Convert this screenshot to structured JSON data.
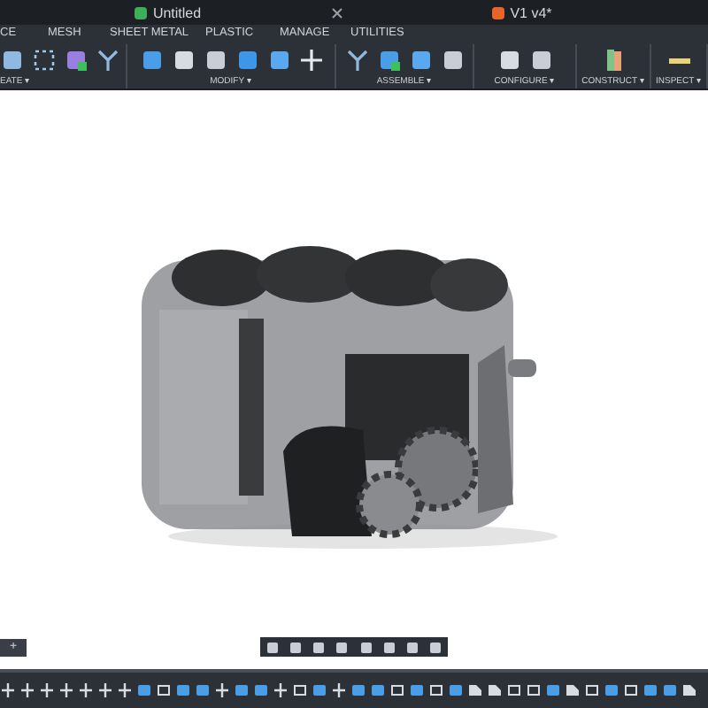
{
  "document_tabs": [
    {
      "title": "Untitled"
    },
    {
      "title": "V1 v4*"
    }
  ],
  "toolbar_tabs": [
    "CE",
    "MESH",
    "SHEET METAL",
    "PLASTIC",
    "MANAGE",
    "UTILITIES"
  ],
  "tool_groups": [
    {
      "label": "EATE ▾"
    },
    {
      "label": "MODIFY ▾"
    },
    {
      "label": "ASSEMBLE ▾"
    },
    {
      "label": "CONFIGURE ▾"
    },
    {
      "label": "CONSTRUCT ▾"
    },
    {
      "label": "INSPECT ▾"
    }
  ],
  "browser_button": "+"
}
